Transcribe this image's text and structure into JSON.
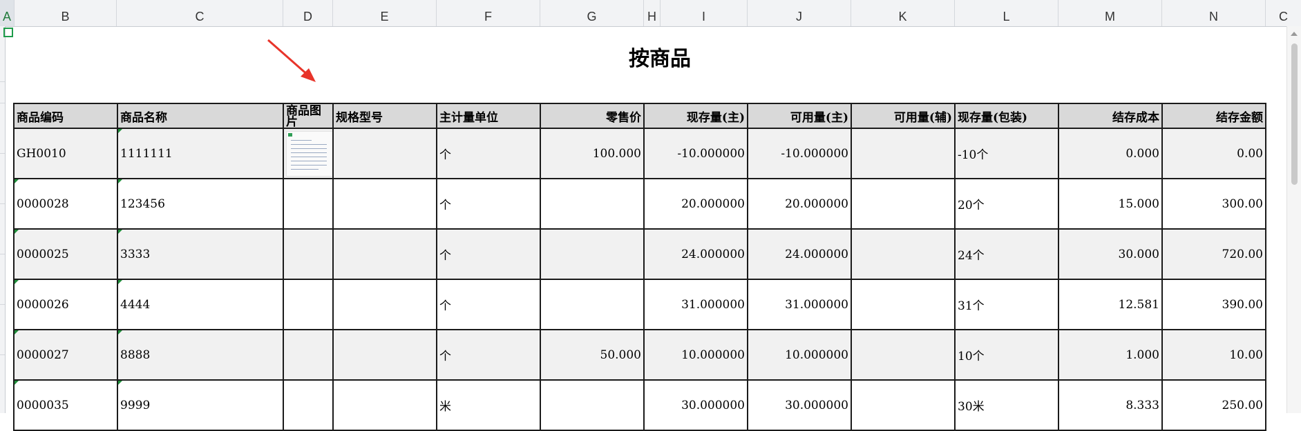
{
  "columns": [
    "A",
    "B",
    "C",
    "D",
    "E",
    "F",
    "G",
    "H",
    "I",
    "J",
    "K",
    "L",
    "M",
    "N",
    "C"
  ],
  "title": "按商品",
  "headers": [
    "商品编码",
    "商品名称",
    "商品图片",
    "规格型号",
    "主计量单位",
    "零售价",
    "现存量(主)",
    "可用量(主)",
    "可用量(辅)",
    "现存量(包装)",
    "结存成本",
    "结存金额"
  ],
  "rows": [
    {
      "code": "GH0010",
      "name": "1111111",
      "spec": "",
      "unit": "个",
      "price": "100.000",
      "stock": "-10.000000",
      "avail": "-10.000000",
      "avail_aux": "",
      "pack": "-10个",
      "cost": "0.000",
      "amount": "0.00"
    },
    {
      "code": "0000028",
      "name": "123456",
      "spec": "",
      "unit": "个",
      "price": "",
      "stock": "20.000000",
      "avail": "20.000000",
      "avail_aux": "",
      "pack": "20个",
      "cost": "15.000",
      "amount": "300.00"
    },
    {
      "code": "0000025",
      "name": "3333",
      "spec": "",
      "unit": "个",
      "price": "",
      "stock": "24.000000",
      "avail": "24.000000",
      "avail_aux": "",
      "pack": "24个",
      "cost": "30.000",
      "amount": "720.00"
    },
    {
      "code": "0000026",
      "name": "4444",
      "spec": "",
      "unit": "个",
      "price": "",
      "stock": "31.000000",
      "avail": "31.000000",
      "avail_aux": "",
      "pack": "31个",
      "cost": "12.581",
      "amount": "390.00"
    },
    {
      "code": "0000027",
      "name": "8888",
      "spec": "",
      "unit": "个",
      "price": "50.000",
      "stock": "10.000000",
      "avail": "10.000000",
      "avail_aux": "",
      "pack": "10个",
      "cost": "1.000",
      "amount": "10.00"
    },
    {
      "code": "0000035",
      "name": "9999",
      "spec": "",
      "unit": "米",
      "price": "",
      "stock": "30.000000",
      "avail": "30.000000",
      "avail_aux": "",
      "pack": "30米",
      "cost": "8.333",
      "amount": "250.00"
    }
  ]
}
